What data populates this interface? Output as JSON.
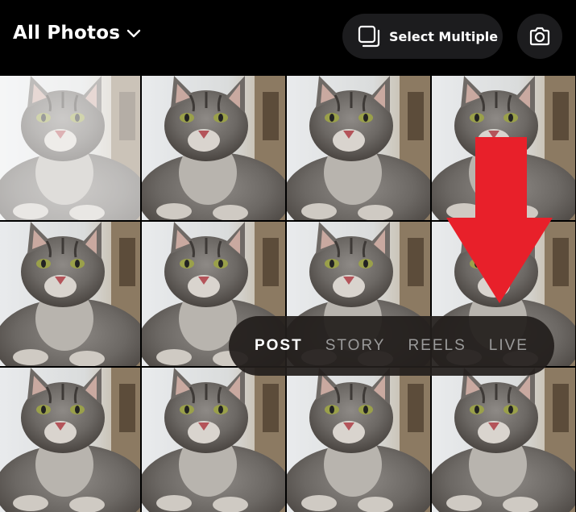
{
  "header": {
    "album_label": "All Photos",
    "album_icon": "chevron-down-icon",
    "select_multiple_label": "Select Multiple",
    "select_multiple_icon": "stacked-squares-icon",
    "camera_icon": "camera-icon"
  },
  "gallery": {
    "tiles": [
      {
        "state": "selected-faded"
      },
      {
        "state": "normal"
      },
      {
        "state": "normal"
      },
      {
        "state": "normal"
      },
      {
        "state": "normal"
      },
      {
        "state": "normal"
      },
      {
        "state": "normal"
      },
      {
        "state": "normal"
      },
      {
        "state": "normal"
      },
      {
        "state": "normal"
      },
      {
        "state": "normal"
      },
      {
        "state": "normal"
      }
    ]
  },
  "overlay": {
    "arrow_icon": "down-arrow-icon",
    "arrow_color": "#e8202a"
  },
  "mode_bar": {
    "modes": [
      "POST",
      "STORY",
      "REELS",
      "LIVE"
    ],
    "active": "POST"
  },
  "colors": {
    "background": "#000000",
    "pill": "#1c1c1e"
  }
}
